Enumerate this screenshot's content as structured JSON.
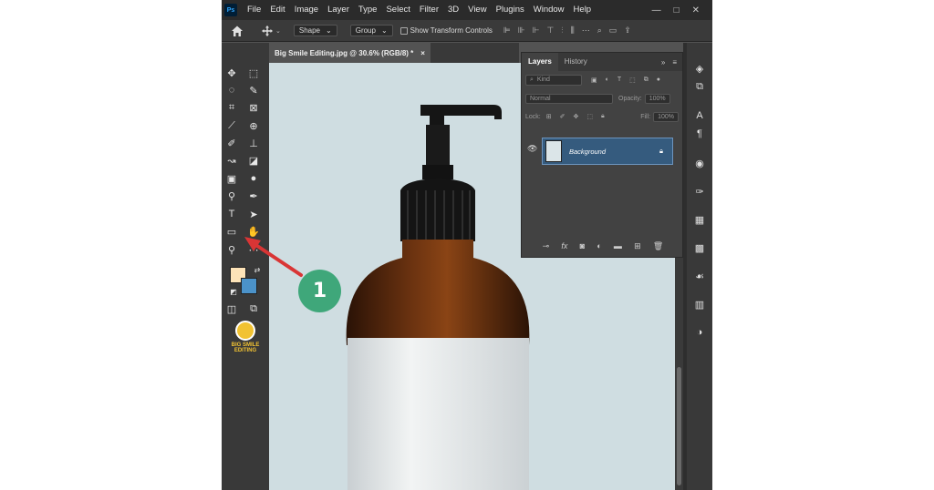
{
  "app": {
    "logo": "Ps"
  },
  "menu": [
    "File",
    "Edit",
    "Image",
    "Layer",
    "Type",
    "Select",
    "Filter",
    "3D",
    "View",
    "Plugins",
    "Window",
    "Help"
  ],
  "window_controls": [
    "—",
    "□",
    "✕"
  ],
  "options": {
    "mode": "Shape",
    "group": "Group",
    "transform_label": "Show Transform Controls"
  },
  "document": {
    "tab_title": "Big Smile Editing.jpg @ 30.6% (RGB/8) *",
    "close": "×"
  },
  "layers_panel": {
    "tabs": [
      "Layers",
      "History"
    ],
    "filter": "Kind",
    "blend_mode": "Normal",
    "opacity_label": "Opacity:",
    "opacity_value": "100%",
    "lock_label": "Lock:",
    "fill_label": "Fill:",
    "fill_value": "100%",
    "layer_name": "Background"
  },
  "brand": {
    "text": "BIG SMILE EDITING"
  },
  "annotation": {
    "number": "1"
  },
  "colors": {
    "foreground": "#fde3b8",
    "background": "#4b92c9",
    "callout": "#3fa77a",
    "arrow": "#d93535"
  }
}
